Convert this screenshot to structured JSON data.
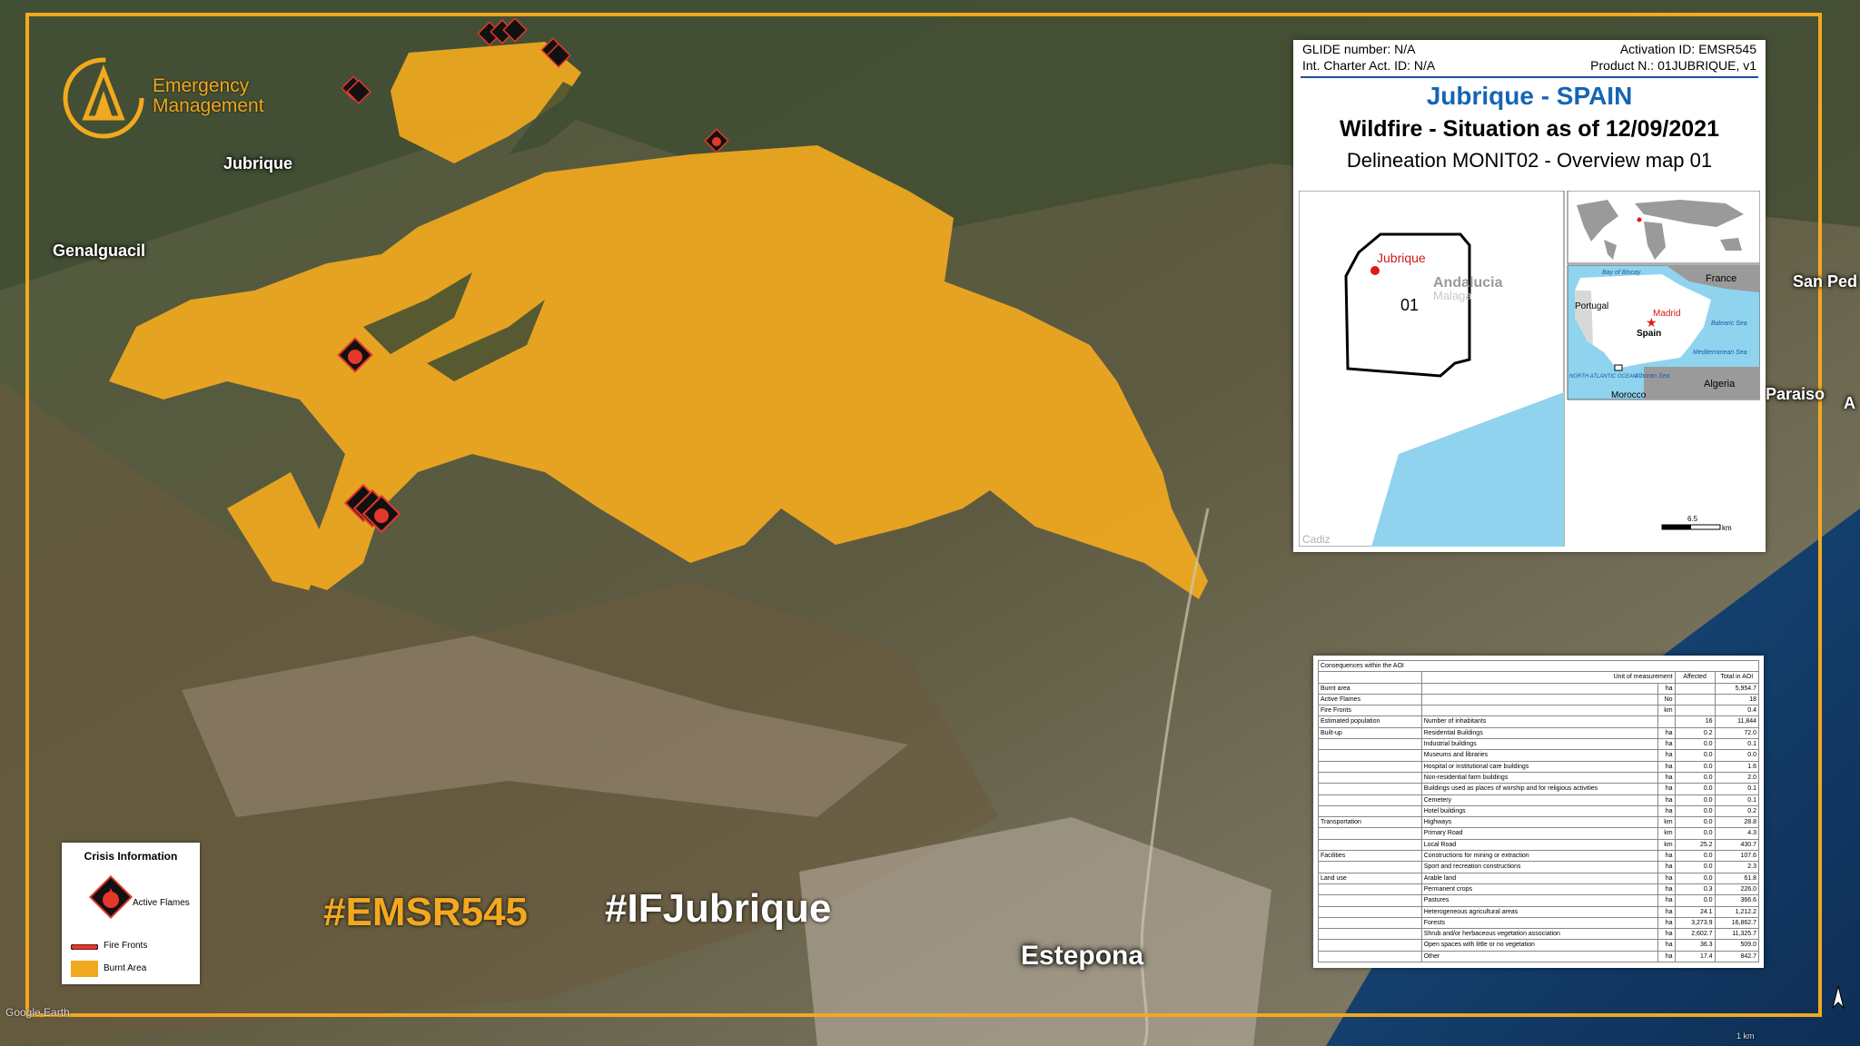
{
  "logo": {
    "line1": "Emergency",
    "line2": "Management"
  },
  "places": {
    "jubrique": "Jubrique",
    "genalguacil": "Genalguacil",
    "san_ped": "San Ped",
    "paraiso": "Paraiso",
    "a": "A",
    "estepona": "Estepona"
  },
  "hashtags": {
    "activation": "#EMSR545",
    "event": "#IFJubrique"
  },
  "info_panel": {
    "glide": "GLIDE number: N/A",
    "activation": "Activation ID: EMSR545",
    "charter": "Int. Charter Act. ID: N/A",
    "product": "Product N.: 01JUBRIQUE, v1",
    "title": "Jubrique - SPAIN",
    "subtitle": "Wildfire - Situation as of 12/09/2021",
    "subtitle2": "Delineation MONIT02 - Overview map 01",
    "inset": {
      "town": "Jubrique",
      "region": "Andalucia",
      "province": "Malaga",
      "aoi": "01",
      "cadiz": "Cadiz",
      "scale": "6.5",
      "scale_unit": "km",
      "countries": {
        "france": "France",
        "portugal": "Portugal",
        "spain": "Spain",
        "madrid": "Madrid",
        "morocco": "Morocco",
        "algeria": "Algeria"
      },
      "seas": {
        "biscay": "Bay of Biscay",
        "balearic": "Balearic Sea",
        "med": "Mediterranean Sea",
        "alboran": "Alboran Sea",
        "atlantic": "NORTH ATLANTIC OCEAN"
      }
    }
  },
  "consequences": {
    "title": "Consequences within the AOI",
    "headers": [
      "Unit of measurement",
      "Affected",
      "Total in AOI"
    ],
    "rows": [
      [
        "Burnt area",
        "",
        "ha",
        "",
        "5,954.7"
      ],
      [
        "Active Flames",
        "",
        "No",
        "",
        "18"
      ],
      [
        "Fire Fronts",
        "",
        "km",
        "",
        "0.4"
      ],
      [
        "Estimated population",
        "Number of inhabitants",
        "",
        "16",
        "11,844"
      ],
      [
        "Built-up",
        "Residential Buildings",
        "ha",
        "0.2",
        "72.0"
      ],
      [
        "",
        "Industrial buildings",
        "ha",
        "0.0",
        "0.1"
      ],
      [
        "",
        "Museums and libraries",
        "ha",
        "0.0",
        "0.0"
      ],
      [
        "",
        "Hospital or institutional care buildings",
        "ha",
        "0.0",
        "1.6"
      ],
      [
        "",
        "Non-residential farm buildings",
        "ha",
        "0.0",
        "2.0"
      ],
      [
        "",
        "Buildings used as places of worship and for religious activities",
        "ha",
        "0.0",
        "0.1"
      ],
      [
        "",
        "Cemetery",
        "ha",
        "0.0",
        "0.1"
      ],
      [
        "",
        "Hotel buildings",
        "ha",
        "0.0",
        "0.2"
      ],
      [
        "Transportation",
        "Highways",
        "km",
        "0.0",
        "28.8"
      ],
      [
        "",
        "Primary Road",
        "km",
        "0.0",
        "4.3"
      ],
      [
        "",
        "Local Road",
        "km",
        "25.2",
        "430.7"
      ],
      [
        "Facilities",
        "Constructions for mining or extraction",
        "ha",
        "0.0",
        "107.6"
      ],
      [
        "",
        "Sport and recreation constructions",
        "ha",
        "0.0",
        "2.3"
      ],
      [
        "Land use",
        "Arable land",
        "ha",
        "0.0",
        "61.8"
      ],
      [
        "",
        "Permanent crops",
        "ha",
        "0.3",
        "226.0"
      ],
      [
        "",
        "Pastures",
        "ha",
        "0.0",
        "366.6"
      ],
      [
        "",
        "Heterogeneous agricultural areas",
        "ha",
        "24.1",
        "1,212.2"
      ],
      [
        "",
        "Forests",
        "ha",
        "3,273.9",
        "16,862.7"
      ],
      [
        "",
        "Shrub and/or herbaceous vegetation association",
        "ha",
        "2,602.7",
        "11,325.7"
      ],
      [
        "",
        "Open spaces with little or no vegetation",
        "ha",
        "36.3",
        "509.0"
      ],
      [
        "",
        "Other",
        "ha",
        "17.4",
        "842.7"
      ]
    ]
  },
  "legend": {
    "title": "Crisis Information",
    "flames": "Active Flames",
    "fronts": "Fire Fronts",
    "burnt": "Burnt Area"
  },
  "footer": {
    "google": "Google Earth",
    "scale": "1 km"
  },
  "colors": {
    "burnt": "#f2a91f",
    "frame": "#f2a91f",
    "sea": "#8fd3ee",
    "title_blue": "#1565b5",
    "flame_red": "#e5372a"
  }
}
